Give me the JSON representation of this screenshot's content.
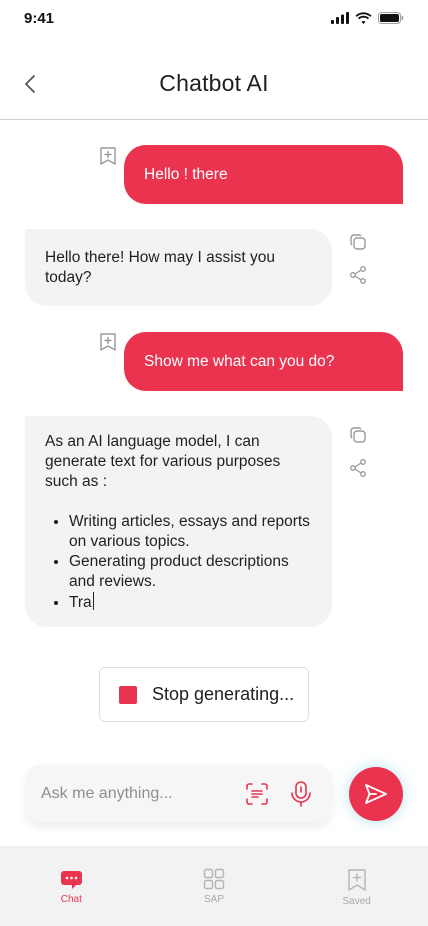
{
  "status_bar": {
    "time": "9:41"
  },
  "header": {
    "title": "Chatbot AI"
  },
  "messages": [
    {
      "role": "user",
      "text": "Hello ! there"
    },
    {
      "role": "bot",
      "text": "Hello there! How may I assist you today?"
    },
    {
      "role": "user",
      "text": "Show me what can you do?"
    },
    {
      "role": "bot",
      "intro": "As an AI language model, I can generate text for various purposes such as :",
      "bullets": [
        "Writing articles, essays and reports on various topics.",
        "Generating product descriptions and reviews.",
        "Tra"
      ]
    }
  ],
  "stop_button": {
    "label": "Stop generating..."
  },
  "composer": {
    "placeholder": "Ask me anything..."
  },
  "tabs": [
    {
      "label": "Chat",
      "icon": "chat-bubble-icon",
      "active": true
    },
    {
      "label": "SAP",
      "icon": "grid-icon",
      "active": false
    },
    {
      "label": "Saved",
      "icon": "bookmark-plus-icon",
      "active": false
    }
  ],
  "colors": {
    "accent": "#ea344f",
    "bot_bubble": "#f3f3f3",
    "tabbar_bg": "#f2f2f2"
  }
}
